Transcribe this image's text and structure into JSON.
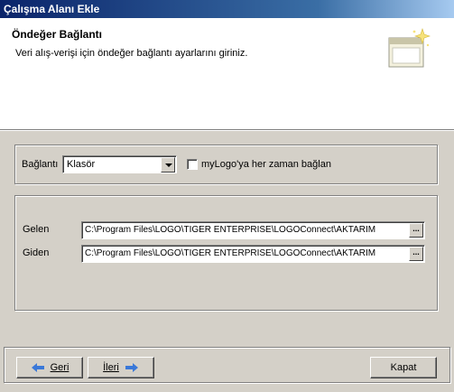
{
  "window": {
    "title": "Çalışma Alanı Ekle"
  },
  "header": {
    "title": "Öndeğer Bağlantı",
    "subtitle": "Veri alış-verişi için öndeğer bağlantı ayarlarını giriniz.",
    "icon": "wizard-window-sparkle-icon"
  },
  "connection": {
    "label": "Bağlantı",
    "selected": "Klasör",
    "checkbox_label": "myLogo'ya her zaman bağlan",
    "checkbox_checked": false
  },
  "folders": {
    "incoming_label": "Gelen",
    "incoming_path": "C:\\Program Files\\LOGO\\TIGER ENTERPRISE\\LOGOConnect\\AKTARIM",
    "outgoing_label": "Giden",
    "outgoing_path": "C:\\Program Files\\LOGO\\TIGER ENTERPRISE\\LOGOConnect\\AKTARIM",
    "browse_label": "..."
  },
  "footer": {
    "back_label": "Geri",
    "next_label": "İleri",
    "close_label": "Kapat",
    "arrow_color": "#3a78d8"
  }
}
